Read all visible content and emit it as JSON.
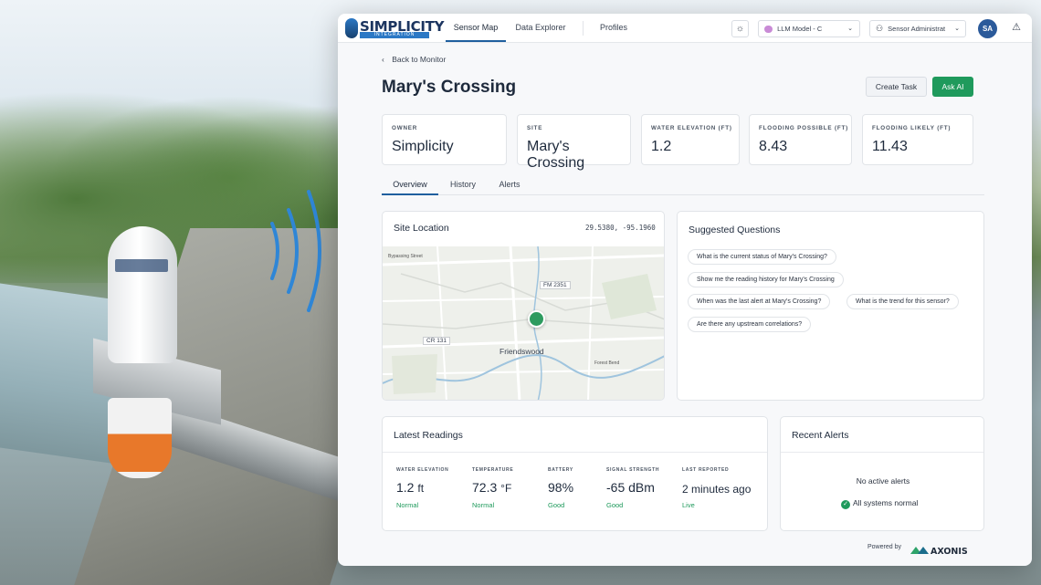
{
  "nav": {
    "brand_name": "SIMPLICITY",
    "brand_sub": "INTEGRATION",
    "tabs": [
      {
        "label": "Sensor Map",
        "active": true
      },
      {
        "label": "Data Explorer",
        "active": false
      },
      {
        "label": "Profiles",
        "active": false
      }
    ],
    "theme_icon": "sun-icon",
    "llm_label": "LLM Model - C",
    "user_label": "Sensor Administrat",
    "avatar_initials": "SA",
    "alert_icon": "warning-triangle-icon"
  },
  "page": {
    "back_label": "Back to Monitor",
    "title": "Mary's Crossing",
    "create_task_label": "Create Task",
    "ask_ai_label": "Ask AI"
  },
  "stats": [
    {
      "label": "Owner",
      "value": "Simplicity"
    },
    {
      "label": "Site",
      "value": "Mary's Crossing"
    },
    {
      "label": "Water Elevation (ft)",
      "value": "1.2"
    },
    {
      "label": "Flooding Possible (ft)",
      "value": "8.43"
    },
    {
      "label": "Flooding Likely (ft)",
      "value": "11.43"
    }
  ],
  "tabs": [
    "Overview",
    "History",
    "Alerts"
  ],
  "site_location": {
    "title": "Site Location",
    "coords": "29.5380, -95.1960",
    "map_labels": {
      "fm": "FM 2351",
      "cr": "CR 131",
      "town": "Friendswood",
      "road1": "Bypassing Street",
      "road2": "Forest Bend"
    }
  },
  "suggested": {
    "title": "Suggested Questions",
    "questions": [
      "What is the current status of Mary's Crossing?",
      "Show me the reading history for Mary's Crossing",
      "When was the last alert at Mary's Crossing?",
      "What is the trend for this sensor?",
      "Are there any upstream correlations?"
    ]
  },
  "latest": {
    "title": "Latest Readings",
    "items": [
      {
        "label": "Water Elevation",
        "value": "1.2",
        "unit": "ft",
        "status": "Normal"
      },
      {
        "label": "Temperature",
        "value": "72.3",
        "unit": "°F",
        "status": "Normal"
      },
      {
        "label": "Battery",
        "value": "98%",
        "unit": "",
        "status": "Good"
      },
      {
        "label": "Signal Strength",
        "value": "-65 dBm",
        "unit": "",
        "status": "Good"
      },
      {
        "label": "Last Reported",
        "value": "2 minutes ago",
        "unit": "",
        "status": "Live"
      }
    ]
  },
  "recent_alerts": {
    "title": "Recent Alerts",
    "empty_label": "No active alerts",
    "status_label": "All systems normal"
  },
  "footer": {
    "powered_label": "Powered by",
    "partner": "AXONIS"
  },
  "colors": {
    "accent_green": "#1f9a5c",
    "nav_active": "#1f5f9e"
  }
}
